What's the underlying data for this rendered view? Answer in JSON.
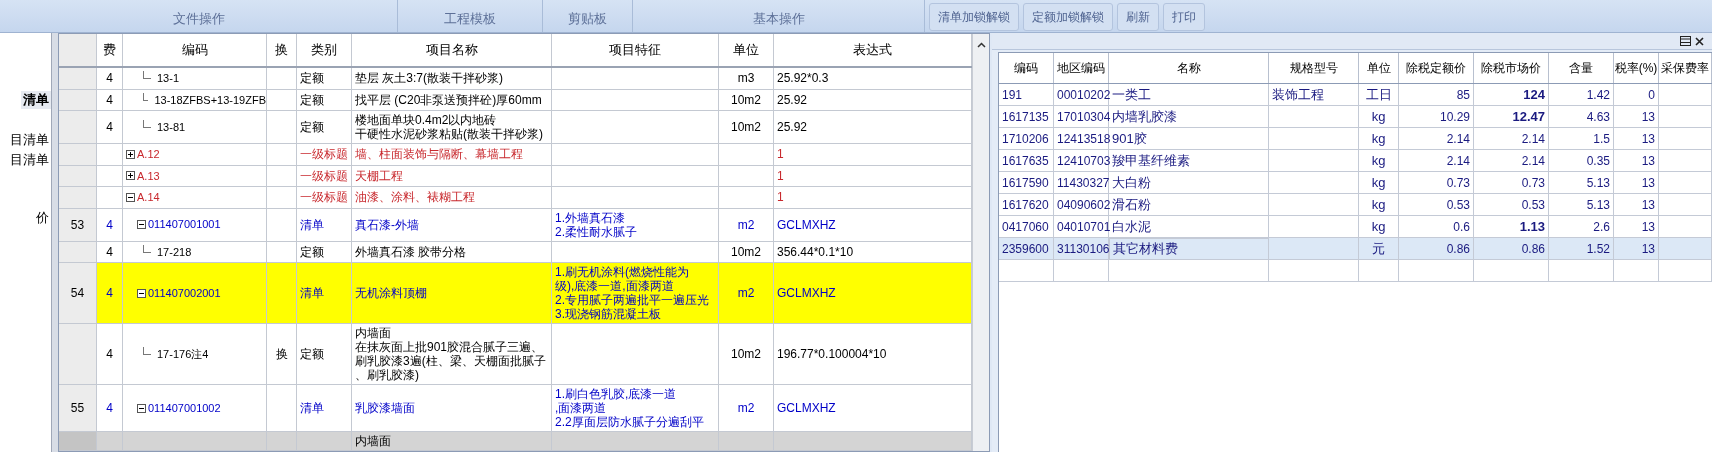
{
  "ribbon": {
    "groups": [
      "文件操作",
      "工程模板",
      "剪贴板",
      "基本操作"
    ],
    "buttons": [
      "清单加锁解锁",
      "定额加锁解锁",
      "刷新",
      "打印"
    ]
  },
  "left_panel": {
    "items": [
      {
        "label": "清单",
        "selected": true
      },
      {
        "label": "目清单",
        "selected": false
      },
      {
        "label": "目清单",
        "selected": false
      },
      {
        "label": "价",
        "selected": false
      }
    ]
  },
  "grid": {
    "columns": [
      "费",
      "编码",
      "换",
      "类别",
      "项目名称",
      "项目特征",
      "单位",
      "表达式"
    ],
    "rows": [
      {
        "kind": "quota",
        "fee": "4",
        "code": "13-1",
        "category": "定额",
        "name": [
          "垫层 灰土3:7(散装干拌砂浆)"
        ],
        "unit": "m3",
        "expression": "25.92*0.3",
        "highlighted": false,
        "selected": false
      },
      {
        "kind": "quota",
        "fee": "4",
        "code": "13-18ZFBS+13-19ZFB",
        "category": "定额",
        "name": [
          "找平层 (C20非泵送预拌砼)厚60mm"
        ],
        "unit": "10m2",
        "expression": "25.92",
        "highlighted": false,
        "selected": false
      },
      {
        "kind": "quota",
        "fee": "4",
        "code": "13-81",
        "category": "定额",
        "name": [
          "楼地面单块0.4m2以内地砖",
          "干硬性水泥砂浆粘贴(散装干拌砂浆)"
        ],
        "unit": "10m2",
        "expression": "25.92",
        "highlighted": false,
        "selected": false
      },
      {
        "kind": "heading",
        "code": "A.12",
        "expanded": false,
        "category": "一级标题",
        "name": [
          "墙、柱面装饰与隔断、幕墙工程"
        ],
        "expression": "1",
        "highlighted": false,
        "selected": false
      },
      {
        "kind": "heading",
        "code": "A.13",
        "expanded": false,
        "category": "一级标题",
        "name": [
          "天棚工程"
        ],
        "expression": "1",
        "highlighted": false,
        "selected": false
      },
      {
        "kind": "heading",
        "code": "A.14",
        "expanded": true,
        "category": "一级标题",
        "name": [
          "油漆、涂料、裱糊工程"
        ],
        "expression": "1",
        "highlighted": false,
        "selected": false
      },
      {
        "kind": "bill",
        "number": "53",
        "fee": "4",
        "code": "011407001001",
        "expanded": true,
        "category": "清单",
        "name": [
          "真石漆-外墙"
        ],
        "feature": [
          "1.外墙真石漆",
          "2.柔性耐水腻子"
        ],
        "unit": "m2",
        "expression": "GCLMXHZ",
        "highlighted": false,
        "selected": false
      },
      {
        "kind": "quota",
        "fee": "4",
        "code": "17-218",
        "category": "定额",
        "name": [
          "外墙真石漆 胶带分格"
        ],
        "unit": "10m2",
        "expression": "356.44*0.1*10",
        "highlighted": false,
        "selected": false
      },
      {
        "kind": "bill",
        "number": "54",
        "fee": "4",
        "code": "011407002001",
        "expanded": true,
        "category": "清单",
        "name": [
          "无机涂料顶棚"
        ],
        "feature": [
          "1.刷无机涂料(燃烧性能为",
          "级),底漆一道,面漆两道",
          "2.专用腻子两遍批平一遍压光",
          "3.现浇钢筋混凝土板"
        ],
        "unit": "m2",
        "expression": "GCLMXHZ",
        "highlighted": true,
        "selected": false
      },
      {
        "kind": "quota",
        "fee": "4",
        "code": "17-176注4",
        "swap": "换",
        "category": "定额",
        "name": [
          "内墙面",
          "在抹灰面上批901胶混合腻子三遍、",
          "刷乳胶漆3遍(柱、梁、天棚面批腻子",
          "、刷乳胶漆)"
        ],
        "unit": "10m2",
        "expression": "196.77*0.100004*10",
        "highlighted": false,
        "selected": false
      },
      {
        "kind": "bill",
        "number": "55",
        "fee": "4",
        "code": "011407001002",
        "expanded": true,
        "category": "清单",
        "name": [
          "乳胶漆墙面"
        ],
        "feature": [
          "1.刷白色乳胶,底漆一道",
          ",面漆两道",
          "2.2厚面层防水腻子分遍刮平"
        ],
        "unit": "m2",
        "expression": "GCLMXHZ",
        "highlighted": false,
        "selected": false
      },
      {
        "kind": "quota",
        "name": [
          "内墙面"
        ],
        "highlighted": false,
        "selected": true
      }
    ]
  },
  "detail": {
    "columns": [
      "编码",
      "地区编码",
      "名称",
      "规格型号",
      "单位",
      "除税定额价",
      "除税市场价",
      "含量",
      "税率(%)",
      "采保费率"
    ],
    "rows": [
      {
        "code": "191",
        "region_code": "00010202",
        "name": "一类工",
        "spec": "装饰工程",
        "unit": "工日",
        "quota_price": "85",
        "market_price": "124",
        "price_changed": true,
        "quantity": "1.42",
        "tax_rate": "0",
        "selected": false
      },
      {
        "code": "1617135",
        "region_code": "17010304",
        "name": "内墙乳胶漆",
        "unit": "kg",
        "quota_price": "10.29",
        "market_price": "12.47",
        "price_changed": true,
        "quantity": "4.63",
        "tax_rate": "13",
        "selected": false
      },
      {
        "code": "1710206",
        "region_code": "12413518",
        "name": "901胶",
        "unit": "kg",
        "quota_price": "2.14",
        "market_price": "2.14",
        "price_changed": false,
        "quantity": "1.5",
        "tax_rate": "13",
        "selected": false
      },
      {
        "code": "1617635",
        "region_code": "12410703",
        "name": "羧甲基纤维素",
        "unit": "kg",
        "quota_price": "2.14",
        "market_price": "2.14",
        "price_changed": false,
        "quantity": "0.35",
        "tax_rate": "13",
        "selected": false
      },
      {
        "code": "1617590",
        "region_code": "11430327",
        "name": "大白粉",
        "unit": "kg",
        "quota_price": "0.73",
        "market_price": "0.73",
        "price_changed": false,
        "quantity": "5.13",
        "tax_rate": "13",
        "selected": false
      },
      {
        "code": "1617620",
        "region_code": "04090602",
        "name": "滑石粉",
        "unit": "kg",
        "quota_price": "0.53",
        "market_price": "0.53",
        "price_changed": false,
        "quantity": "5.13",
        "tax_rate": "13",
        "selected": false
      },
      {
        "code": "0417060",
        "region_code": "04010701",
        "name": "白水泥",
        "unit": "kg",
        "quota_price": "0.6",
        "market_price": "1.13",
        "price_changed": true,
        "quantity": "2.6",
        "tax_rate": "13",
        "selected": false
      },
      {
        "code": "2359600",
        "region_code": "31130106",
        "name": "其它材料费",
        "unit": "元",
        "quota_price": "0.86",
        "market_price": "0.86",
        "price_changed": false,
        "quantity": "1.52",
        "tax_rate": "13",
        "selected": true
      }
    ]
  }
}
